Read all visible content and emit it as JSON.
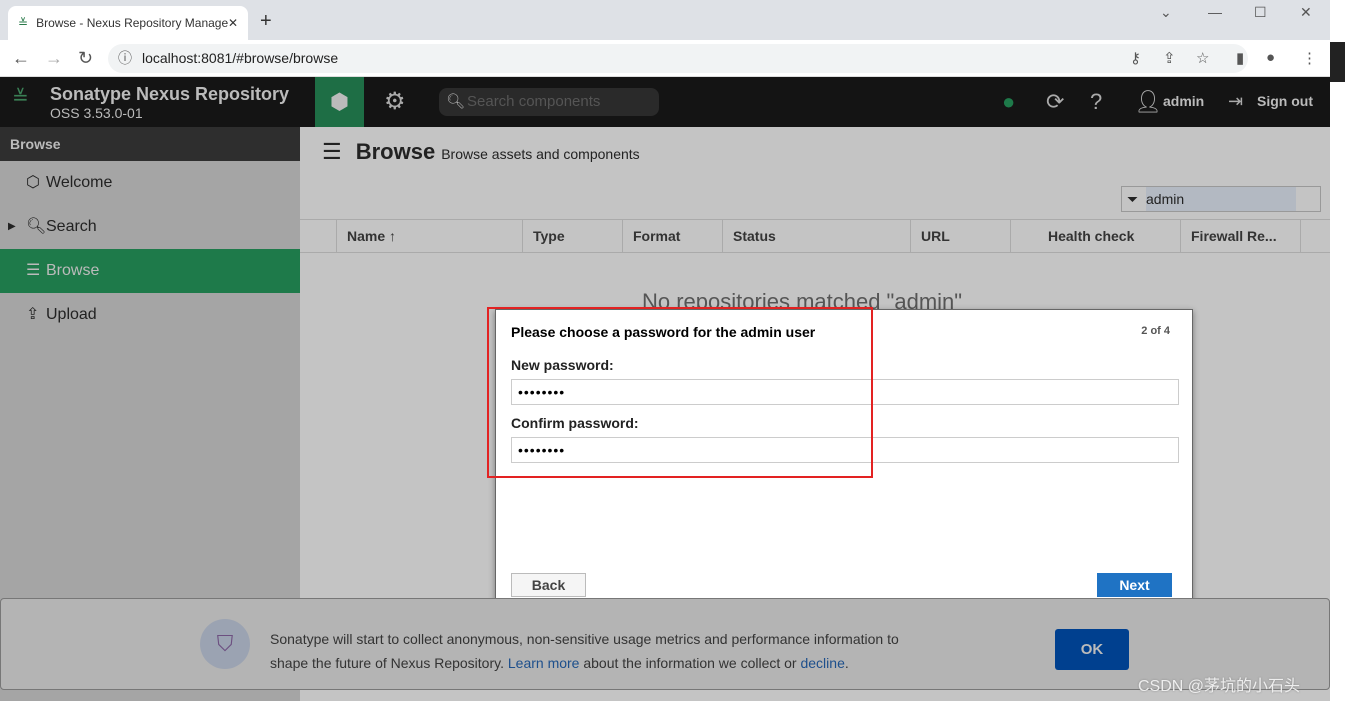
{
  "browser": {
    "tab_title": "Browse - Nexus Repository Manager",
    "url": "localhost:8081/#browse/browse"
  },
  "header": {
    "brand": "Sonatype Nexus Repository",
    "version": "OSS 3.53.0-01",
    "search_placeholder": "Search components",
    "user": "admin",
    "signout": "Sign out"
  },
  "sidebar": {
    "title": "Browse",
    "items": [
      {
        "label": "Welcome"
      },
      {
        "label": "Search"
      },
      {
        "label": "Browse"
      },
      {
        "label": "Upload"
      }
    ]
  },
  "main": {
    "title": "Browse",
    "subtitle": "Browse assets and components",
    "filter_value": "admin",
    "columns": [
      "Name ↑",
      "Type",
      "Format",
      "Status",
      "URL",
      "Health check",
      "Firewall Re..."
    ],
    "empty_text": "No repositories matched \"admin\""
  },
  "modal": {
    "title": "Please choose a password for the admin user",
    "step": "2 of 4",
    "new_label": "New password:",
    "new_value": "••••••••",
    "confirm_label": "Confirm password:",
    "confirm_value": "••••••••",
    "back": "Back",
    "next": "Next"
  },
  "banner": {
    "text1": "Sonatype will start to collect anonymous, non-sensitive usage metrics and performance information to",
    "text2a": "shape the future of Nexus Repository. ",
    "learn_more": "Learn more",
    "text2b": " about the information we collect or ",
    "decline": "decline",
    "text2c": ".",
    "ok": "OK"
  },
  "watermark": "CSDN @茅坑的小石头"
}
